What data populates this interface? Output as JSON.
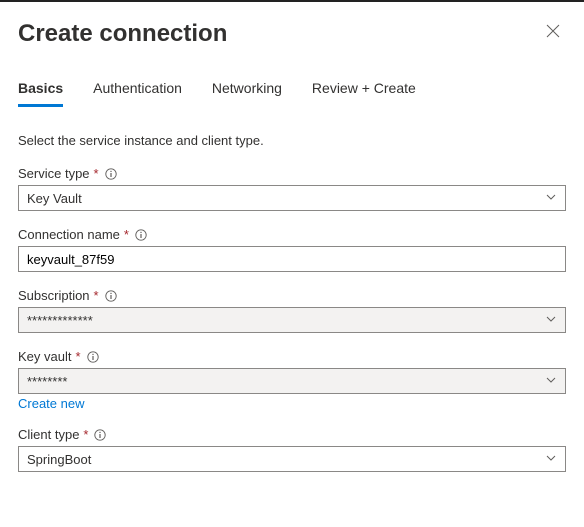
{
  "header": {
    "title": "Create connection"
  },
  "tabs": {
    "basics": "Basics",
    "authentication": "Authentication",
    "networking": "Networking",
    "review": "Review + Create"
  },
  "intro": "Select the service instance and client type.",
  "fields": {
    "service_type": {
      "label": "Service type",
      "value": "Key Vault"
    },
    "connection_name": {
      "label": "Connection name",
      "value": "keyvault_87f59"
    },
    "subscription": {
      "label": "Subscription",
      "value": "*************"
    },
    "key_vault": {
      "label": "Key vault",
      "value": "********",
      "create_new": "Create new"
    },
    "client_type": {
      "label": "Client type",
      "value": "SpringBoot"
    }
  }
}
